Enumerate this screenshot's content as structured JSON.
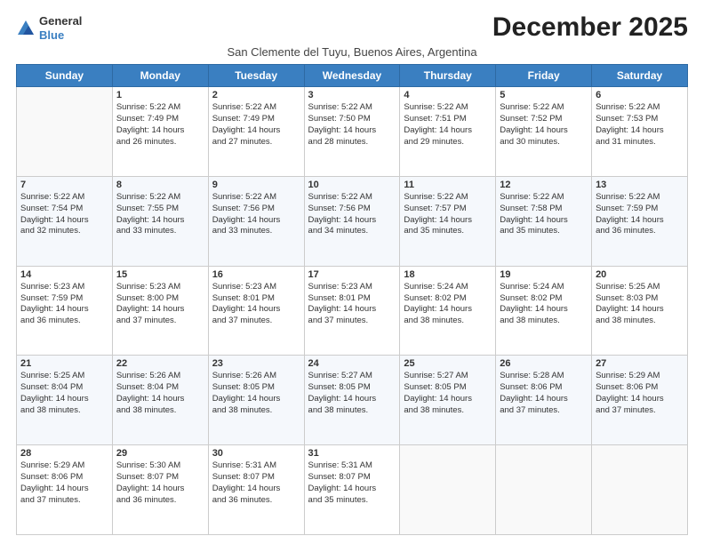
{
  "logo": {
    "general": "General",
    "blue": "Blue"
  },
  "title": "December 2025",
  "subtitle": "San Clemente del Tuyu, Buenos Aires, Argentina",
  "weekdays": [
    "Sunday",
    "Monday",
    "Tuesday",
    "Wednesday",
    "Thursday",
    "Friday",
    "Saturday"
  ],
  "weeks": [
    [
      {
        "date": "",
        "sunrise": "",
        "sunset": "",
        "daylight": ""
      },
      {
        "date": "1",
        "sunrise": "Sunrise: 5:22 AM",
        "sunset": "Sunset: 7:49 PM",
        "daylight": "Daylight: 14 hours",
        "dayl2": "and 26 minutes."
      },
      {
        "date": "2",
        "sunrise": "Sunrise: 5:22 AM",
        "sunset": "Sunset: 7:49 PM",
        "daylight": "Daylight: 14 hours",
        "dayl2": "and 27 minutes."
      },
      {
        "date": "3",
        "sunrise": "Sunrise: 5:22 AM",
        "sunset": "Sunset: 7:50 PM",
        "daylight": "Daylight: 14 hours",
        "dayl2": "and 28 minutes."
      },
      {
        "date": "4",
        "sunrise": "Sunrise: 5:22 AM",
        "sunset": "Sunset: 7:51 PM",
        "daylight": "Daylight: 14 hours",
        "dayl2": "and 29 minutes."
      },
      {
        "date": "5",
        "sunrise": "Sunrise: 5:22 AM",
        "sunset": "Sunset: 7:52 PM",
        "daylight": "Daylight: 14 hours",
        "dayl2": "and 30 minutes."
      },
      {
        "date": "6",
        "sunrise": "Sunrise: 5:22 AM",
        "sunset": "Sunset: 7:53 PM",
        "daylight": "Daylight: 14 hours",
        "dayl2": "and 31 minutes."
      }
    ],
    [
      {
        "date": "7",
        "sunrise": "Sunrise: 5:22 AM",
        "sunset": "Sunset: 7:54 PM",
        "daylight": "Daylight: 14 hours",
        "dayl2": "and 32 minutes."
      },
      {
        "date": "8",
        "sunrise": "Sunrise: 5:22 AM",
        "sunset": "Sunset: 7:55 PM",
        "daylight": "Daylight: 14 hours",
        "dayl2": "and 33 minutes."
      },
      {
        "date": "9",
        "sunrise": "Sunrise: 5:22 AM",
        "sunset": "Sunset: 7:56 PM",
        "daylight": "Daylight: 14 hours",
        "dayl2": "and 33 minutes."
      },
      {
        "date": "10",
        "sunrise": "Sunrise: 5:22 AM",
        "sunset": "Sunset: 7:56 PM",
        "daylight": "Daylight: 14 hours",
        "dayl2": "and 34 minutes."
      },
      {
        "date": "11",
        "sunrise": "Sunrise: 5:22 AM",
        "sunset": "Sunset: 7:57 PM",
        "daylight": "Daylight: 14 hours",
        "dayl2": "and 35 minutes."
      },
      {
        "date": "12",
        "sunrise": "Sunrise: 5:22 AM",
        "sunset": "Sunset: 7:58 PM",
        "daylight": "Daylight: 14 hours",
        "dayl2": "and 35 minutes."
      },
      {
        "date": "13",
        "sunrise": "Sunrise: 5:22 AM",
        "sunset": "Sunset: 7:59 PM",
        "daylight": "Daylight: 14 hours",
        "dayl2": "and 36 minutes."
      }
    ],
    [
      {
        "date": "14",
        "sunrise": "Sunrise: 5:23 AM",
        "sunset": "Sunset: 7:59 PM",
        "daylight": "Daylight: 14 hours",
        "dayl2": "and 36 minutes."
      },
      {
        "date": "15",
        "sunrise": "Sunrise: 5:23 AM",
        "sunset": "Sunset: 8:00 PM",
        "daylight": "Daylight: 14 hours",
        "dayl2": "and 37 minutes."
      },
      {
        "date": "16",
        "sunrise": "Sunrise: 5:23 AM",
        "sunset": "Sunset: 8:01 PM",
        "daylight": "Daylight: 14 hours",
        "dayl2": "and 37 minutes."
      },
      {
        "date": "17",
        "sunrise": "Sunrise: 5:23 AM",
        "sunset": "Sunset: 8:01 PM",
        "daylight": "Daylight: 14 hours",
        "dayl2": "and 37 minutes."
      },
      {
        "date": "18",
        "sunrise": "Sunrise: 5:24 AM",
        "sunset": "Sunset: 8:02 PM",
        "daylight": "Daylight: 14 hours",
        "dayl2": "and 38 minutes."
      },
      {
        "date": "19",
        "sunrise": "Sunrise: 5:24 AM",
        "sunset": "Sunset: 8:02 PM",
        "daylight": "Daylight: 14 hours",
        "dayl2": "and 38 minutes."
      },
      {
        "date": "20",
        "sunrise": "Sunrise: 5:25 AM",
        "sunset": "Sunset: 8:03 PM",
        "daylight": "Daylight: 14 hours",
        "dayl2": "and 38 minutes."
      }
    ],
    [
      {
        "date": "21",
        "sunrise": "Sunrise: 5:25 AM",
        "sunset": "Sunset: 8:04 PM",
        "daylight": "Daylight: 14 hours",
        "dayl2": "and 38 minutes."
      },
      {
        "date": "22",
        "sunrise": "Sunrise: 5:26 AM",
        "sunset": "Sunset: 8:04 PM",
        "daylight": "Daylight: 14 hours",
        "dayl2": "and 38 minutes."
      },
      {
        "date": "23",
        "sunrise": "Sunrise: 5:26 AM",
        "sunset": "Sunset: 8:05 PM",
        "daylight": "Daylight: 14 hours",
        "dayl2": "and 38 minutes."
      },
      {
        "date": "24",
        "sunrise": "Sunrise: 5:27 AM",
        "sunset": "Sunset: 8:05 PM",
        "daylight": "Daylight: 14 hours",
        "dayl2": "and 38 minutes."
      },
      {
        "date": "25",
        "sunrise": "Sunrise: 5:27 AM",
        "sunset": "Sunset: 8:05 PM",
        "daylight": "Daylight: 14 hours",
        "dayl2": "and 38 minutes."
      },
      {
        "date": "26",
        "sunrise": "Sunrise: 5:28 AM",
        "sunset": "Sunset: 8:06 PM",
        "daylight": "Daylight: 14 hours",
        "dayl2": "and 37 minutes."
      },
      {
        "date": "27",
        "sunrise": "Sunrise: 5:29 AM",
        "sunset": "Sunset: 8:06 PM",
        "daylight": "Daylight: 14 hours",
        "dayl2": "and 37 minutes."
      }
    ],
    [
      {
        "date": "28",
        "sunrise": "Sunrise: 5:29 AM",
        "sunset": "Sunset: 8:06 PM",
        "daylight": "Daylight: 14 hours",
        "dayl2": "and 37 minutes."
      },
      {
        "date": "29",
        "sunrise": "Sunrise: 5:30 AM",
        "sunset": "Sunset: 8:07 PM",
        "daylight": "Daylight: 14 hours",
        "dayl2": "and 36 minutes."
      },
      {
        "date": "30",
        "sunrise": "Sunrise: 5:31 AM",
        "sunset": "Sunset: 8:07 PM",
        "daylight": "Daylight: 14 hours",
        "dayl2": "and 36 minutes."
      },
      {
        "date": "31",
        "sunrise": "Sunrise: 5:31 AM",
        "sunset": "Sunset: 8:07 PM",
        "daylight": "Daylight: 14 hours",
        "dayl2": "and 35 minutes."
      },
      {
        "date": "",
        "sunrise": "",
        "sunset": "",
        "daylight": "",
        "dayl2": ""
      },
      {
        "date": "",
        "sunrise": "",
        "sunset": "",
        "daylight": "",
        "dayl2": ""
      },
      {
        "date": "",
        "sunrise": "",
        "sunset": "",
        "daylight": "",
        "dayl2": ""
      }
    ]
  ]
}
